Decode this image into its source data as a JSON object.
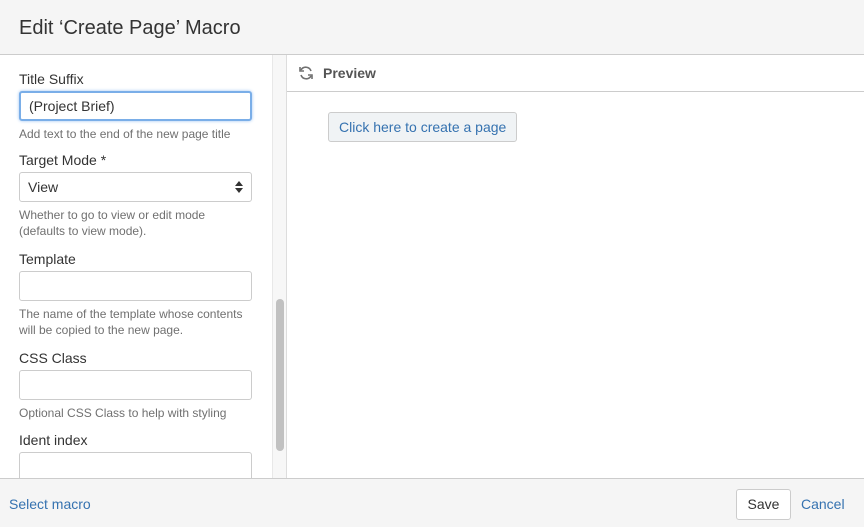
{
  "dialog": {
    "title": "Edit ‘Create Page’ Macro"
  },
  "form": {
    "title_suffix": {
      "label": "Title Suffix",
      "value": "(Project Brief)",
      "help": "Add text to the end of the new page title"
    },
    "target_mode": {
      "label": "Target Mode *",
      "value": "View",
      "help": "Whether to go to view or edit mode (defaults to view mode)."
    },
    "template": {
      "label": "Template",
      "value": "",
      "help": "The name of the template whose contents will be copied to the new page."
    },
    "css_class": {
      "label": "CSS Class",
      "value": "",
      "help": "Optional CSS Class to help with styling"
    },
    "ident_index": {
      "label": "Ident index",
      "value": ""
    }
  },
  "preview": {
    "title": "Preview",
    "button": "Click here to create a page"
  },
  "footer": {
    "select_macro": "Select macro",
    "save": "Save",
    "cancel": "Cancel"
  },
  "colors": {
    "link": "#3572b0",
    "focus": "#7aaee8"
  }
}
